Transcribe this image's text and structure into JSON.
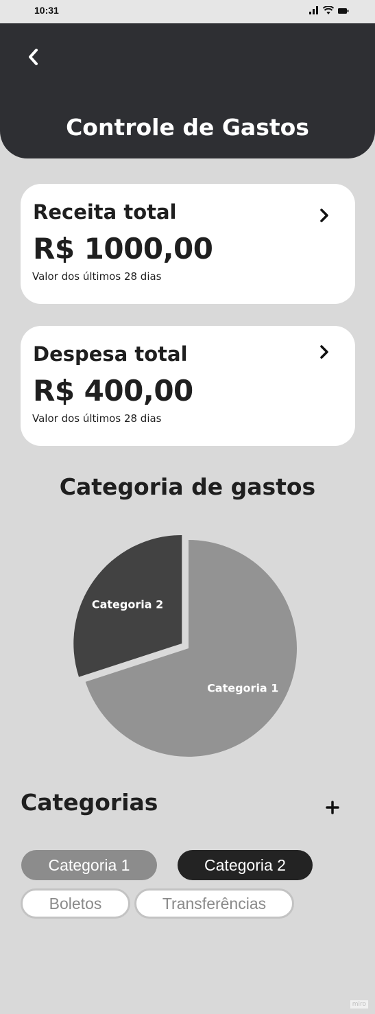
{
  "status_bar": {
    "time": "10:31"
  },
  "header": {
    "title": "Controle de Gastos"
  },
  "cards": [
    {
      "title": "Receita total",
      "value": "R$ 1000,00",
      "caption": "Valor dos últimos 28 dias"
    },
    {
      "title": "Despesa total",
      "value": "R$ 400,00",
      "caption": "Valor dos últimos 28 dias"
    }
  ],
  "chart_section": {
    "title": "Categoria de gastos"
  },
  "chart_data": {
    "type": "pie",
    "slices": [
      {
        "label": "Categoria 1",
        "value": 70,
        "color": "#939393"
      },
      {
        "label": "Categoria 2",
        "value": 30,
        "color": "#424242"
      }
    ],
    "title": "",
    "legend": "none"
  },
  "categories": {
    "title": "Categorias",
    "add_label": "+",
    "chips": [
      {
        "label": "Categoria 1",
        "style": "gray"
      },
      {
        "label": "Categoria 2",
        "style": "dark"
      },
      {
        "label": "Boletos",
        "style": "outline"
      },
      {
        "label": "Transferências",
        "style": "outline"
      }
    ]
  },
  "watermark": "miro"
}
